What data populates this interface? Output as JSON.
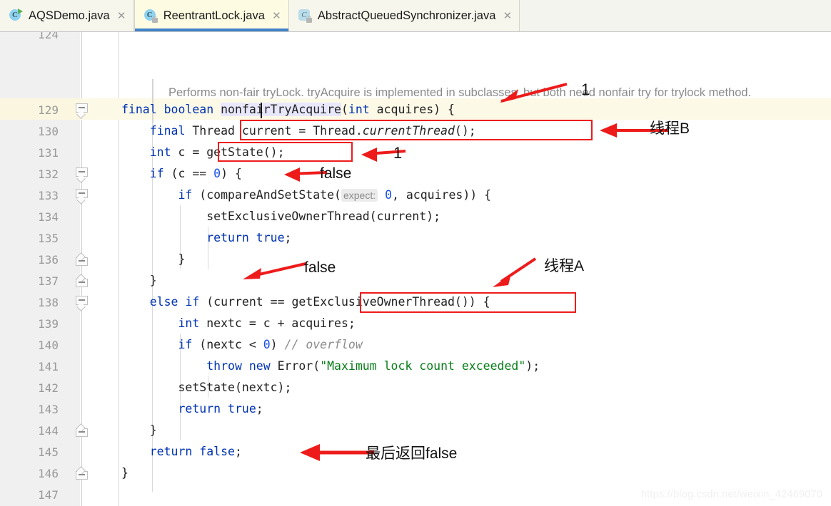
{
  "window": {
    "app": "IntelliJ IDEA Editor",
    "watermark": "https://blog.csdn.net/weixin_42469070"
  },
  "tabs": [
    {
      "label": "AQSDemo.java",
      "icon": "java-class-runnable-icon",
      "close": "✕",
      "active": false,
      "letter": "C",
      "modifier": "run"
    },
    {
      "label": "ReentrantLock.java",
      "icon": "java-class-readonly-icon",
      "close": "✕",
      "active": true,
      "letter": "C",
      "modifier": "lock"
    },
    {
      "label": "AbstractQueuedSynchronizer.java",
      "icon": "java-abstract-class-readonly-icon",
      "close": "✕",
      "active": false,
      "letter": "C",
      "modifier": "lock"
    }
  ],
  "editor": {
    "javadoc": "Performs non-fair tryLock. tryAcquire is implemented in subclasses, but both need nonfair try for trylock method.",
    "partial_top_line_number": "124",
    "lines": [
      {
        "num": "129",
        "current": true,
        "fold": "collapse",
        "indent": 0
      },
      {
        "num": "130",
        "current": false,
        "fold": "none",
        "indent": 1
      },
      {
        "num": "131",
        "current": false,
        "fold": "none",
        "indent": 1
      },
      {
        "num": "132",
        "current": false,
        "fold": "collapse",
        "indent": 1
      },
      {
        "num": "133",
        "current": false,
        "fold": "collapse",
        "indent": 2
      },
      {
        "num": "134",
        "current": false,
        "fold": "none",
        "indent": 3
      },
      {
        "num": "135",
        "current": false,
        "fold": "none",
        "indent": 3
      },
      {
        "num": "136",
        "current": false,
        "fold": "end",
        "indent": 2
      },
      {
        "num": "137",
        "current": false,
        "fold": "end",
        "indent": 1
      },
      {
        "num": "138",
        "current": false,
        "fold": "collapse",
        "indent": 1
      },
      {
        "num": "139",
        "current": false,
        "fold": "none",
        "indent": 2
      },
      {
        "num": "140",
        "current": false,
        "fold": "none",
        "indent": 2
      },
      {
        "num": "141",
        "current": false,
        "fold": "none",
        "indent": 3
      },
      {
        "num": "142",
        "current": false,
        "fold": "none",
        "indent": 2
      },
      {
        "num": "143",
        "current": false,
        "fold": "none",
        "indent": 2
      },
      {
        "num": "144",
        "current": false,
        "fold": "end",
        "indent": 1
      },
      {
        "num": "145",
        "current": false,
        "fold": "none",
        "indent": 1
      },
      {
        "num": "146",
        "current": false,
        "fold": "end",
        "indent": 0
      },
      {
        "num": "147",
        "current": false,
        "fold": "none",
        "indent": 0
      }
    ],
    "code": {
      "l129": "final boolean nonfairTryAcquire(int acquires) {",
      "l130": "    final Thread current = Thread.currentThread();",
      "l131": "    int c = getState();",
      "l132": "    if (c == 0) {",
      "l133": "        if (compareAndSetState( expect: 0, acquires)) {",
      "l134": "            setExclusiveOwnerThread(current);",
      "l135": "            return true;",
      "l136": "        }",
      "l137": "    }",
      "l138": "    else if (current == getExclusiveOwnerThread()) {",
      "l139": "        int nextc = c + acquires;",
      "l140": "        if (nextc < 0) // overflow",
      "l141": "            throw new Error(\"Maximum lock count exceeded\");",
      "l142": "        setState(nextc);",
      "l143": "        return true;",
      "l144": "    }",
      "l145": "    return false;",
      "l146": "}"
    },
    "parameter_hint": "expect:"
  },
  "annotations": [
    {
      "id": "a1",
      "text": "1",
      "kind": "number"
    },
    {
      "id": "a2",
      "text": "线程B",
      "kind": "chinese"
    },
    {
      "id": "a3",
      "text": "1",
      "kind": "number"
    },
    {
      "id": "a4",
      "text": "false",
      "kind": "english"
    },
    {
      "id": "a5",
      "text": "false",
      "kind": "english"
    },
    {
      "id": "a6",
      "text": "线程A",
      "kind": "chinese"
    },
    {
      "id": "a7",
      "text": "最后返回false",
      "kind": "chinese"
    }
  ],
  "colors": {
    "annotation_red": "#ee1b1b",
    "keyword_blue": "#0033b3",
    "string_green": "#067d17",
    "comment_gray": "#8c8c8c",
    "current_line": "#fdf9e7",
    "active_tab": "#fdfce2",
    "tab_underline": "#4083c9"
  }
}
